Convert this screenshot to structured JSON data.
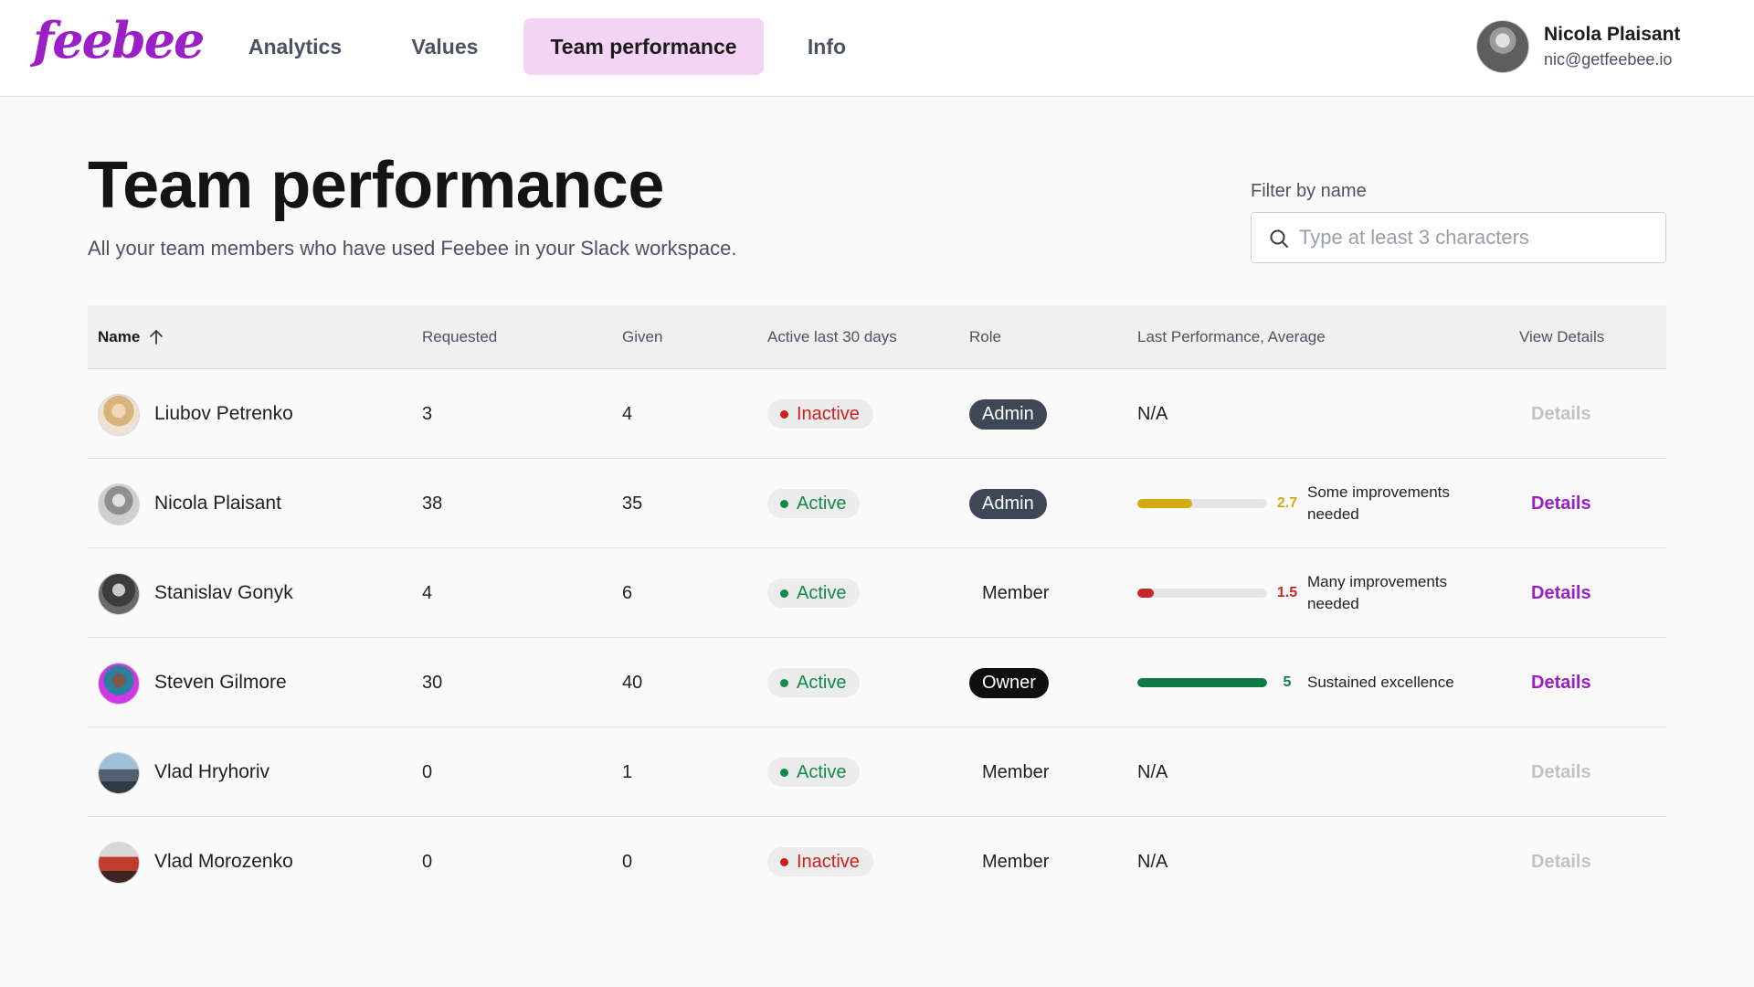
{
  "header": {
    "logo": "feebee",
    "nav": [
      {
        "label": "Analytics",
        "active": false
      },
      {
        "label": "Values",
        "active": false
      },
      {
        "label": "Team performance",
        "active": true
      },
      {
        "label": "Info",
        "active": false
      }
    ],
    "user": {
      "name": "Nicola Plaisant",
      "email": "nic@getfeebee.io",
      "avatar": "avatar-icon"
    }
  },
  "page": {
    "title": "Team performance",
    "subtitle": "All your team members who have used Feebee in your Slack workspace."
  },
  "filter": {
    "label": "Filter by name",
    "placeholder": "Type at least 3 characters",
    "value": ""
  },
  "table": {
    "columns": {
      "name": "Name",
      "requested": "Requested",
      "given": "Given",
      "active": "Active last 30 days",
      "role": "Role",
      "performance": "Last Performance, Average",
      "view": "View Details"
    },
    "sort": {
      "column": "name",
      "direction": "asc"
    },
    "rows": [
      {
        "name": "Liubov Petrenko",
        "requested": "3",
        "given": "4",
        "status": "Inactive",
        "role": "Admin",
        "perf_na": "N/A",
        "score": "",
        "score_value": 0,
        "perf_label": "",
        "details": "Details",
        "details_enabled": false
      },
      {
        "name": "Nicola Plaisant",
        "requested": "38",
        "given": "35",
        "status": "Active",
        "role": "Admin",
        "perf_na": "",
        "score": "2.7",
        "score_value": 2.7,
        "perf_label": "Some improvements needed",
        "details": "Details",
        "details_enabled": true
      },
      {
        "name": "Stanislav Gonyk",
        "requested": "4",
        "given": "6",
        "status": "Active",
        "role": "Member",
        "perf_na": "",
        "score": "1.5",
        "score_value": 1.5,
        "perf_label": "Many improvements needed",
        "details": "Details",
        "details_enabled": true
      },
      {
        "name": "Steven Gilmore",
        "requested": "30",
        "given": "40",
        "status": "Active",
        "role": "Owner",
        "perf_na": "",
        "score": "5",
        "score_value": 5,
        "perf_label": "Sustained excellence",
        "details": "Details",
        "details_enabled": true
      },
      {
        "name": "Vlad Hryhoriv",
        "requested": "0",
        "given": "1",
        "status": "Active",
        "role": "Member",
        "perf_na": "N/A",
        "score": "",
        "score_value": 0,
        "perf_label": "",
        "details": "Details",
        "details_enabled": false
      },
      {
        "name": "Vlad Morozenko",
        "requested": "0",
        "given": "0",
        "status": "Inactive",
        "role": "Member",
        "perf_na": "N/A",
        "score": "",
        "score_value": 0,
        "perf_label": "",
        "details": "Details",
        "details_enabled": false
      }
    ]
  },
  "colors": {
    "brand": "#9b1ec6",
    "nav_active_bg": "#f4d4f4",
    "active": "#108a4a",
    "inactive": "#cc1f1f",
    "perf_low": "#c62828",
    "perf_mid": "#d4aa12",
    "perf_high": "#0f7a46"
  }
}
